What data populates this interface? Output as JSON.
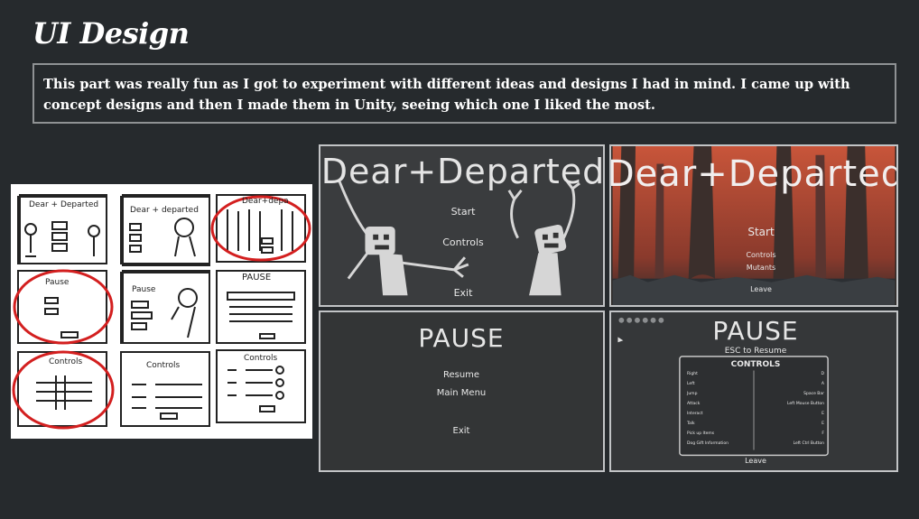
{
  "page": {
    "title": "UI Design",
    "description": "This part was really fun as I got to experiment with different ideas and designs I had in mind. I came up with concept designs and then I made them in Unity, seeing which one I liked the most."
  },
  "sketches": {
    "labels": [
      "Dear + Departed",
      "Dear + departed",
      "Dear+depa",
      "Pause",
      "Pause",
      "PAUSE",
      "Controls",
      "Controls",
      "Controls"
    ]
  },
  "menu_a": {
    "title": "Dear+Departed",
    "items": [
      "Start",
      "Controls",
      "Exit"
    ]
  },
  "menu_b": {
    "title": "Dear+Departed",
    "items": [
      "Start",
      "Controls",
      "Mutants",
      "Leave"
    ]
  },
  "pause_a": {
    "title": "PAUSE",
    "items": [
      "Resume",
      "Main Menu",
      "Exit"
    ]
  },
  "pause_b": {
    "title": "PAUSE",
    "subtitle": "ESC to Resume",
    "controls_title": "CONTROLS",
    "rows": [
      {
        "action": "Right",
        "key": "D"
      },
      {
        "action": "Left",
        "key": "A"
      },
      {
        "action": "Jump",
        "key": "Space Bar"
      },
      {
        "action": "Attack",
        "key": "Left Mouse Button"
      },
      {
        "action": "Interact",
        "key": "E"
      },
      {
        "action": "Talk",
        "key": "E"
      },
      {
        "action": "Pick up Items",
        "key": "F"
      },
      {
        "action": "Dog Gift Information",
        "key": "Left Ctrl Button"
      }
    ],
    "leave": "Leave"
  },
  "colors": {
    "background": "#262a2d",
    "border": "#8f9294",
    "sketch_circle": "#d31f1f",
    "forest_orange": "#c8553a"
  }
}
